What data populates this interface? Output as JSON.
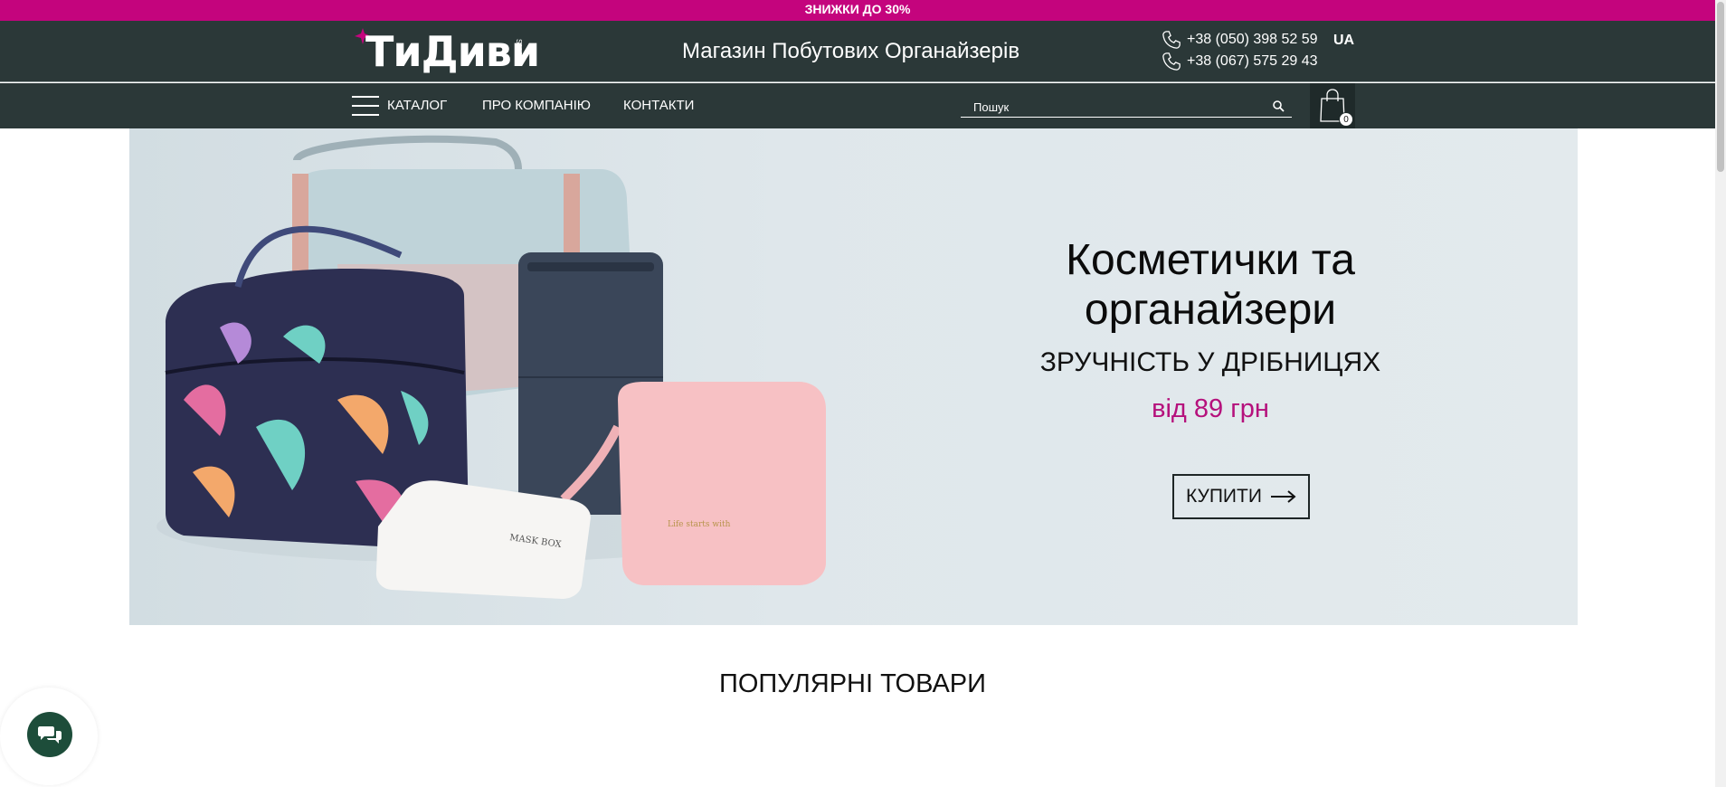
{
  "promo": {
    "text": "ЗНИЖКИ ДО 30%"
  },
  "header": {
    "logo_text": "ТиДиви",
    "logo_sub": "SHOP",
    "tagline": "Магазин Побутових Органайзерів",
    "phones": [
      "+38 (050) 398 52 59",
      "+38 (067) 575 29 43"
    ],
    "lang": "UA"
  },
  "nav": {
    "catalog": "КАТАЛОГ",
    "about": "ПРО КОМПАНІЮ",
    "contacts": "КОНТАКТИ",
    "search_placeholder": "Пошук",
    "cart_count": "0"
  },
  "hero": {
    "title": "Косметички та органайзери",
    "subtitle": "ЗРУЧНІСТЬ У ДРІБНИЦЯХ",
    "price": "від 89 грн",
    "button": "КУПИТИ",
    "product_print_1": "MASK BOX",
    "product_print_2": "Life starts with"
  },
  "sections": {
    "popular_title": "ПОПУЛЯРНІ ТОВАРИ"
  },
  "colors": {
    "promo": "#c4047d",
    "header": "#2b3838",
    "accent_price": "#b5117c",
    "chat": "#1d4d3a"
  },
  "icons": [
    "phone-icon",
    "burger-menu-icon",
    "search-icon",
    "shopping-bag-icon",
    "arrow-right-icon",
    "chat-icon"
  ]
}
